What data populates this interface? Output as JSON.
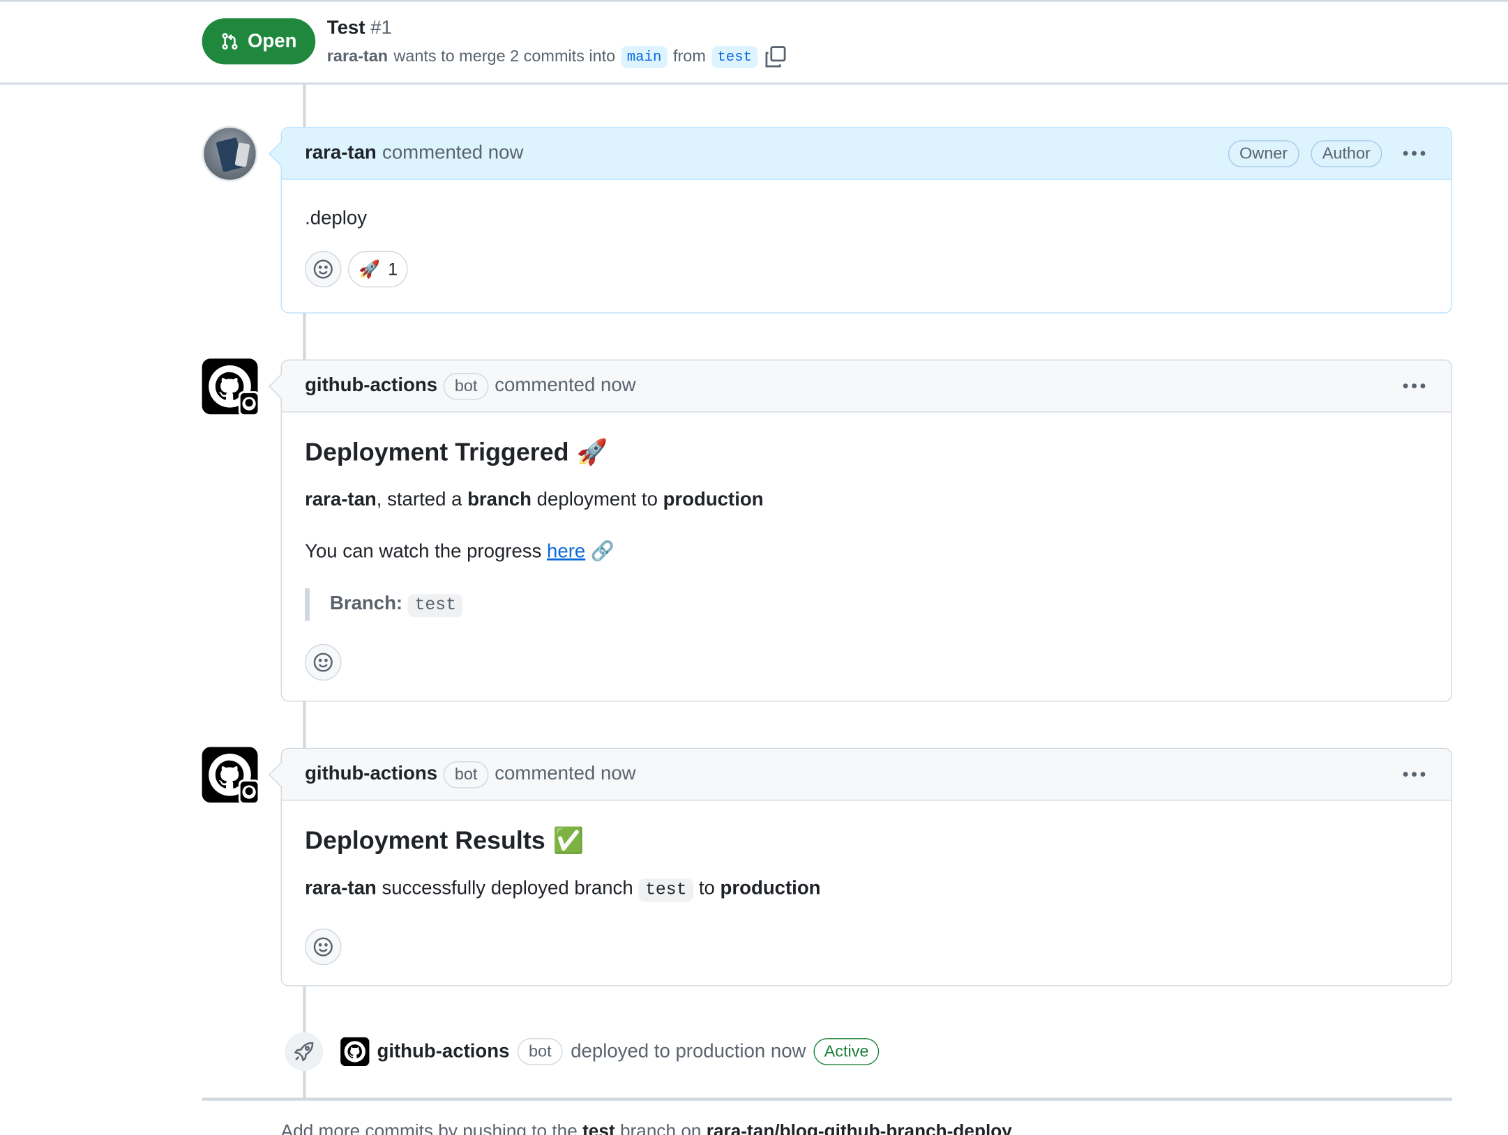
{
  "pull_request": {
    "state": "Open",
    "title": "Test",
    "number": "#1",
    "author": "rara-tan",
    "merge_text": "wants to merge 2 commits into",
    "base_branch": "main",
    "from_text": "from",
    "head_branch": "test"
  },
  "comments": [
    {
      "author": "rara-tan",
      "time": "commented now",
      "labels": [
        "Owner",
        "Author"
      ],
      "body": ".deploy",
      "reactions": [
        {
          "emoji": "🚀",
          "count": "1"
        }
      ]
    },
    {
      "author": "github-actions",
      "bot_label": "bot",
      "time": "commented now",
      "heading": "Deployment Triggered",
      "heading_emoji": "🚀",
      "line1": {
        "user": "rara-tan",
        "t1": ", started a ",
        "kind": "branch",
        "t2": " deployment to ",
        "env": "production"
      },
      "line2": {
        "text": "You can watch the progress ",
        "link": "here",
        "emoji": "🔗"
      },
      "quote": {
        "label": "Branch:",
        "value": "test"
      }
    },
    {
      "author": "github-actions",
      "bot_label": "bot",
      "time": "commented now",
      "heading": "Deployment Results",
      "heading_emoji": "✅",
      "line": {
        "user": "rara-tan",
        "t1": " successfully deployed branch ",
        "branch": "test",
        "t2": " to ",
        "env": "production"
      }
    }
  ],
  "deploy_event": {
    "actor": "github-actions",
    "bot_label": "bot",
    "text": "deployed to production now",
    "status": "Active"
  },
  "footer": {
    "t1": "Add more commits by pushing to the ",
    "branch": "test",
    "t2": " branch on ",
    "repo": "rara-tan/blog-github-branch-deploy",
    "t3": "."
  },
  "colors": {
    "open_green": "#1f883d",
    "owner_header": "#ddf4ff",
    "link_blue": "#0969da",
    "active_green": "#1a7f37"
  }
}
